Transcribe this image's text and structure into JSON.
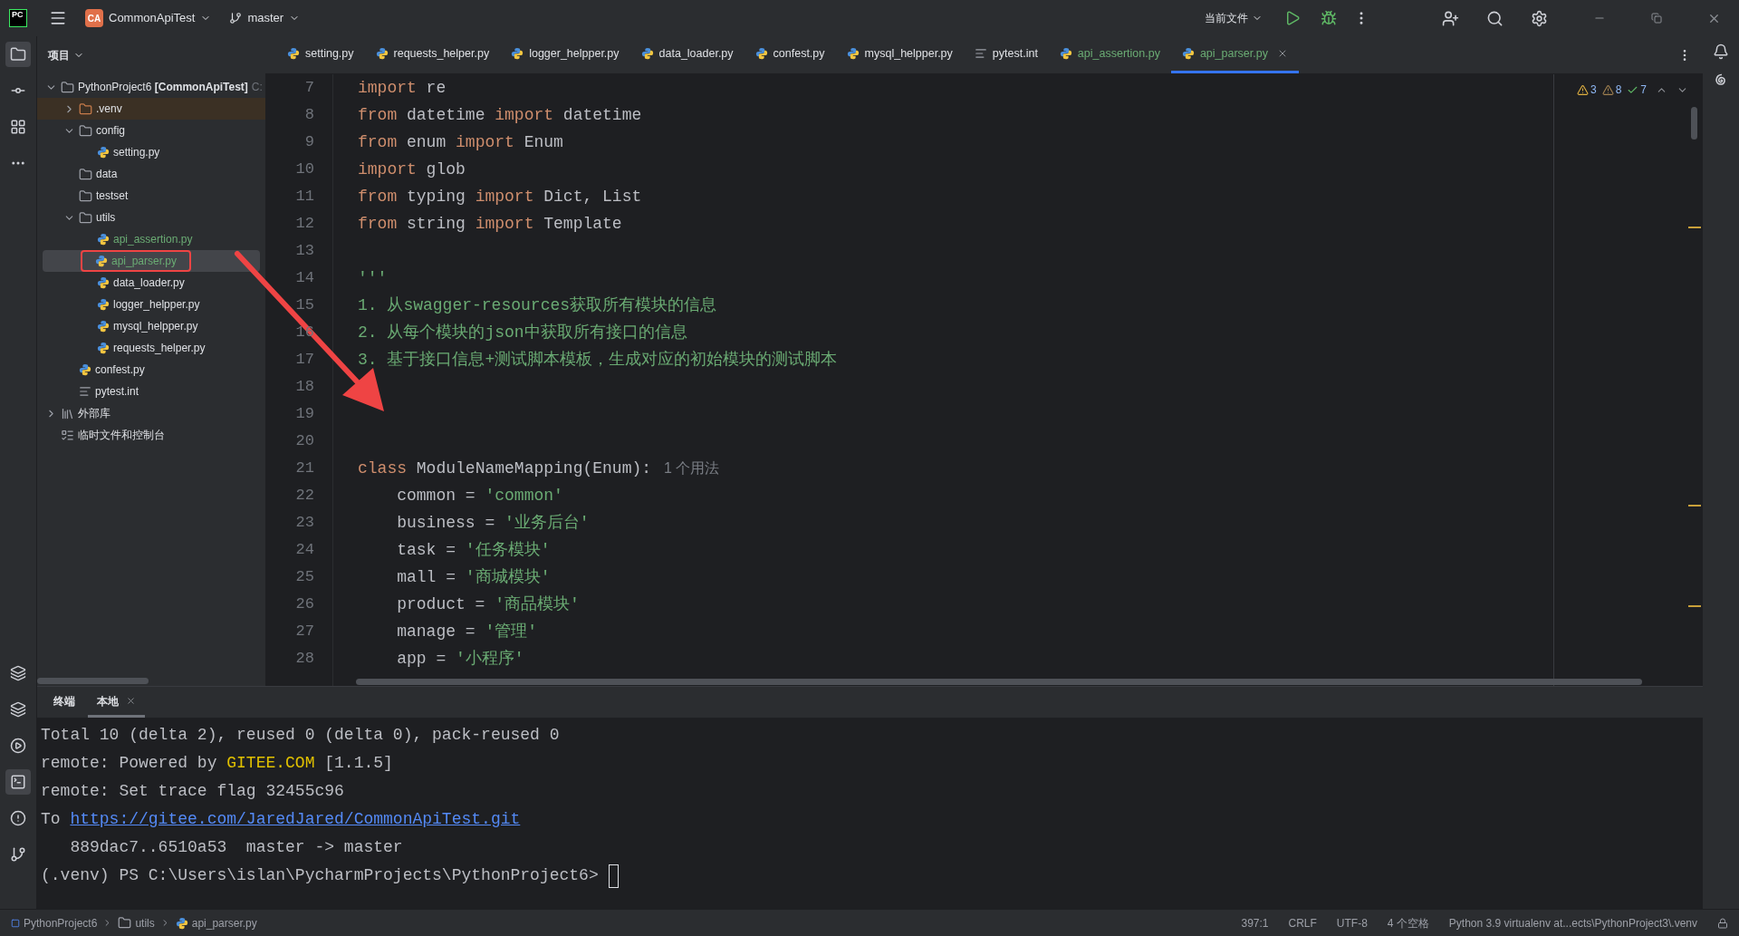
{
  "title_bar": {
    "logo": "PC",
    "project_badge": "CA",
    "project": "CommonApiTest",
    "branch": "master",
    "run_config": "当前文件"
  },
  "project_panel": {
    "title": "项目",
    "tree": [
      {
        "kind": "folder",
        "label": "PythonProject6 **[CommonApiTest]**",
        "suffix": "C:",
        "expanded": true,
        "selected": false,
        "added": false,
        "annotated": false,
        "children": [
          {
            "kind": "excluded",
            "label": ".venv",
            "expanded": false,
            "selected": false,
            "added": false,
            "annotated": false
          },
          {
            "kind": "folder",
            "label": "config",
            "expanded": true,
            "selected": false,
            "added": false,
            "annotated": false,
            "children": [
              {
                "kind": "python",
                "label": "setting.py",
                "selected": false,
                "added": false,
                "annotated": false
              }
            ]
          },
          {
            "kind": "folder",
            "label": "data",
            "selected": false,
            "added": false,
            "annotated": false
          },
          {
            "kind": "folder",
            "label": "testset",
            "selected": false,
            "added": false,
            "annotated": false
          },
          {
            "kind": "folder",
            "label": "utils",
            "expanded": true,
            "selected": false,
            "added": false,
            "annotated": false,
            "children": [
              {
                "kind": "python",
                "label": "api_assertion.py",
                "selected": false,
                "added": true,
                "annotated": false
              },
              {
                "kind": "python",
                "label": "api_parser.py",
                "selected": true,
                "added": true,
                "annotated": true
              },
              {
                "kind": "python",
                "label": "data_loader.py",
                "selected": false,
                "added": false,
                "annotated": false
              },
              {
                "kind": "python",
                "label": "logger_helpper.py",
                "selected": false,
                "added": false,
                "annotated": false
              },
              {
                "kind": "python",
                "label": "mysql_helpper.py",
                "selected": false,
                "added": false,
                "annotated": false
              },
              {
                "kind": "python",
                "label": "requests_helper.py",
                "selected": false,
                "added": false,
                "annotated": false
              }
            ]
          },
          {
            "kind": "python",
            "label": "confest.py",
            "selected": false,
            "added": false,
            "annotated": false
          },
          {
            "kind": "text",
            "label": "pytest.int",
            "selected": false,
            "added": false,
            "annotated": false
          }
        ]
      },
      {
        "kind": "library",
        "label": "外部库",
        "expanded": false,
        "selected": false,
        "added": false,
        "annotated": false
      },
      {
        "kind": "scratch",
        "label": "临时文件和控制台",
        "selected": false,
        "added": false,
        "annotated": false
      }
    ]
  },
  "tabs": [
    {
      "kind": "python",
      "label": "setting.py",
      "selected": false,
      "added": false
    },
    {
      "kind": "python",
      "label": "requests_helper.py",
      "selected": false,
      "added": false
    },
    {
      "kind": "python",
      "label": "logger_helpper.py",
      "selected": false,
      "added": false
    },
    {
      "kind": "python",
      "label": "data_loader.py",
      "selected": false,
      "added": false
    },
    {
      "kind": "python",
      "label": "confest.py",
      "selected": false,
      "added": false
    },
    {
      "kind": "python",
      "label": "mysql_helpper.py",
      "selected": false,
      "added": false
    },
    {
      "kind": "text",
      "label": "pytest.int",
      "selected": false,
      "added": false
    },
    {
      "kind": "python",
      "label": "api_assertion.py",
      "selected": false,
      "added": true
    },
    {
      "kind": "python",
      "label": "api_parser.py",
      "selected": true,
      "added": true
    }
  ],
  "inspections": {
    "warnings": "3",
    "weak_warnings": "8",
    "typos": "7"
  },
  "code": [
    {
      "n": "7",
      "tokens": [
        {
          "kind": "kw",
          "text": "import"
        },
        {
          "kind": "plain",
          "text": " re"
        }
      ]
    },
    {
      "n": "8",
      "tokens": [
        {
          "kind": "kw",
          "text": "from"
        },
        {
          "kind": "plain",
          "text": " datetime "
        },
        {
          "kind": "kw",
          "text": "import"
        },
        {
          "kind": "plain",
          "text": " datetime"
        }
      ]
    },
    {
      "n": "9",
      "tokens": [
        {
          "kind": "kw",
          "text": "from"
        },
        {
          "kind": "plain",
          "text": " enum "
        },
        {
          "kind": "kw",
          "text": "import"
        },
        {
          "kind": "plain",
          "text": " Enum"
        }
      ]
    },
    {
      "n": "10",
      "tokens": [
        {
          "kind": "kw",
          "text": "import"
        },
        {
          "kind": "plain",
          "text": " glob"
        }
      ]
    },
    {
      "n": "11",
      "tokens": [
        {
          "kind": "kw",
          "text": "from"
        },
        {
          "kind": "plain",
          "text": " typing "
        },
        {
          "kind": "kw",
          "text": "import"
        },
        {
          "kind": "plain",
          "text": " Dict, List"
        }
      ]
    },
    {
      "n": "12",
      "tokens": [
        {
          "kind": "kw",
          "text": "from"
        },
        {
          "kind": "plain",
          "text": " string "
        },
        {
          "kind": "kw",
          "text": "import"
        },
        {
          "kind": "plain",
          "text": " Template"
        }
      ]
    },
    {
      "n": "13"
    },
    {
      "n": "14",
      "tokens": [
        {
          "kind": "str",
          "text": "'''"
        }
      ]
    },
    {
      "n": "15",
      "tokens": [
        {
          "kind": "str",
          "text": "1. 从swagger-resources获取所有模块的信息"
        }
      ]
    },
    {
      "n": "16",
      "tokens": [
        {
          "kind": "str",
          "text": "2. 从每个模块的json中获取所有接口的信息"
        }
      ]
    },
    {
      "n": "17",
      "tokens": [
        {
          "kind": "str",
          "text": "3. 基于接口信息+测试脚本模板，生成对应的初始模块的测试脚本"
        }
      ]
    },
    {
      "n": "18"
    },
    {
      "n": "19"
    },
    {
      "n": "20"
    },
    {
      "n": "21",
      "tokens": [
        {
          "kind": "kw",
          "text": "class"
        },
        {
          "kind": "plain",
          "text": " ModuleNameMapping(Enum):"
        },
        {
          "kind": "hint",
          "text": "1 个用法"
        }
      ]
    },
    {
      "n": "22",
      "tokens": [
        {
          "kind": "plain",
          "text": "    common = "
        },
        {
          "kind": "str",
          "text": "'common'"
        }
      ]
    },
    {
      "n": "23",
      "tokens": [
        {
          "kind": "plain",
          "text": "    business = "
        },
        {
          "kind": "str",
          "text": "'业务后台'"
        }
      ]
    },
    {
      "n": "24",
      "tokens": [
        {
          "kind": "plain",
          "text": "    task = "
        },
        {
          "kind": "str",
          "text": "'任务模块'"
        }
      ]
    },
    {
      "n": "25",
      "tokens": [
        {
          "kind": "plain",
          "text": "    mall = "
        },
        {
          "kind": "str",
          "text": "'商城模块'"
        }
      ]
    },
    {
      "n": "26",
      "tokens": [
        {
          "kind": "plain",
          "text": "    product = "
        },
        {
          "kind": "str",
          "text": "'商品模块'"
        }
      ]
    },
    {
      "n": "27",
      "tokens": [
        {
          "kind": "plain",
          "text": "    manage = "
        },
        {
          "kind": "str",
          "text": "'管理'"
        }
      ]
    },
    {
      "n": "28",
      "tokens": [
        {
          "kind": "plain",
          "text": "    app = "
        },
        {
          "kind": "str",
          "text": "'小程序'"
        }
      ]
    }
  ],
  "terminal": {
    "tabs": [
      {
        "label": "终端",
        "kind": "title",
        "selected": false
      },
      {
        "label": "本地",
        "kind": "session",
        "selected": true
      }
    ],
    "lines": [
      [
        {
          "kind": "plain",
          "text": "Total 10 (delta 2), reused 0 (delta 0), pack-reused 0"
        }
      ],
      [
        {
          "kind": "plain",
          "text": "remote: Powered by "
        },
        {
          "kind": "highlight",
          "text": "GITEE.COM"
        },
        {
          "kind": "plain",
          "text": " [1.1.5]"
        }
      ],
      [
        {
          "kind": "plain",
          "text": "remote: Set trace flag 32455c96"
        }
      ],
      [
        {
          "kind": "plain",
          "text": "To "
        },
        {
          "kind": "link",
          "text": "https://gitee.com/JaredJared/CommonApiTest.git"
        }
      ],
      [
        {
          "kind": "plain",
          "text": "   889dac7..6510a53  master -> master"
        }
      ],
      [
        {
          "kind": "plain",
          "text": "(.venv) PS C:\\Users\\islan\\PycharmProjects\\PythonProject6> "
        },
        {
          "kind": "cursor"
        }
      ]
    ]
  },
  "status_bar": {
    "breadcrumbs": [
      {
        "kind": "module",
        "label": "PythonProject6"
      },
      {
        "kind": "folder",
        "label": "utils"
      },
      {
        "kind": "python",
        "label": "api_parser.py"
      }
    ],
    "items": [
      "397:1",
      "CRLF",
      "UTF-8",
      "4 个空格",
      "Python 3.9 virtualenv at...ects\\PythonProject3\\.venv"
    ]
  }
}
